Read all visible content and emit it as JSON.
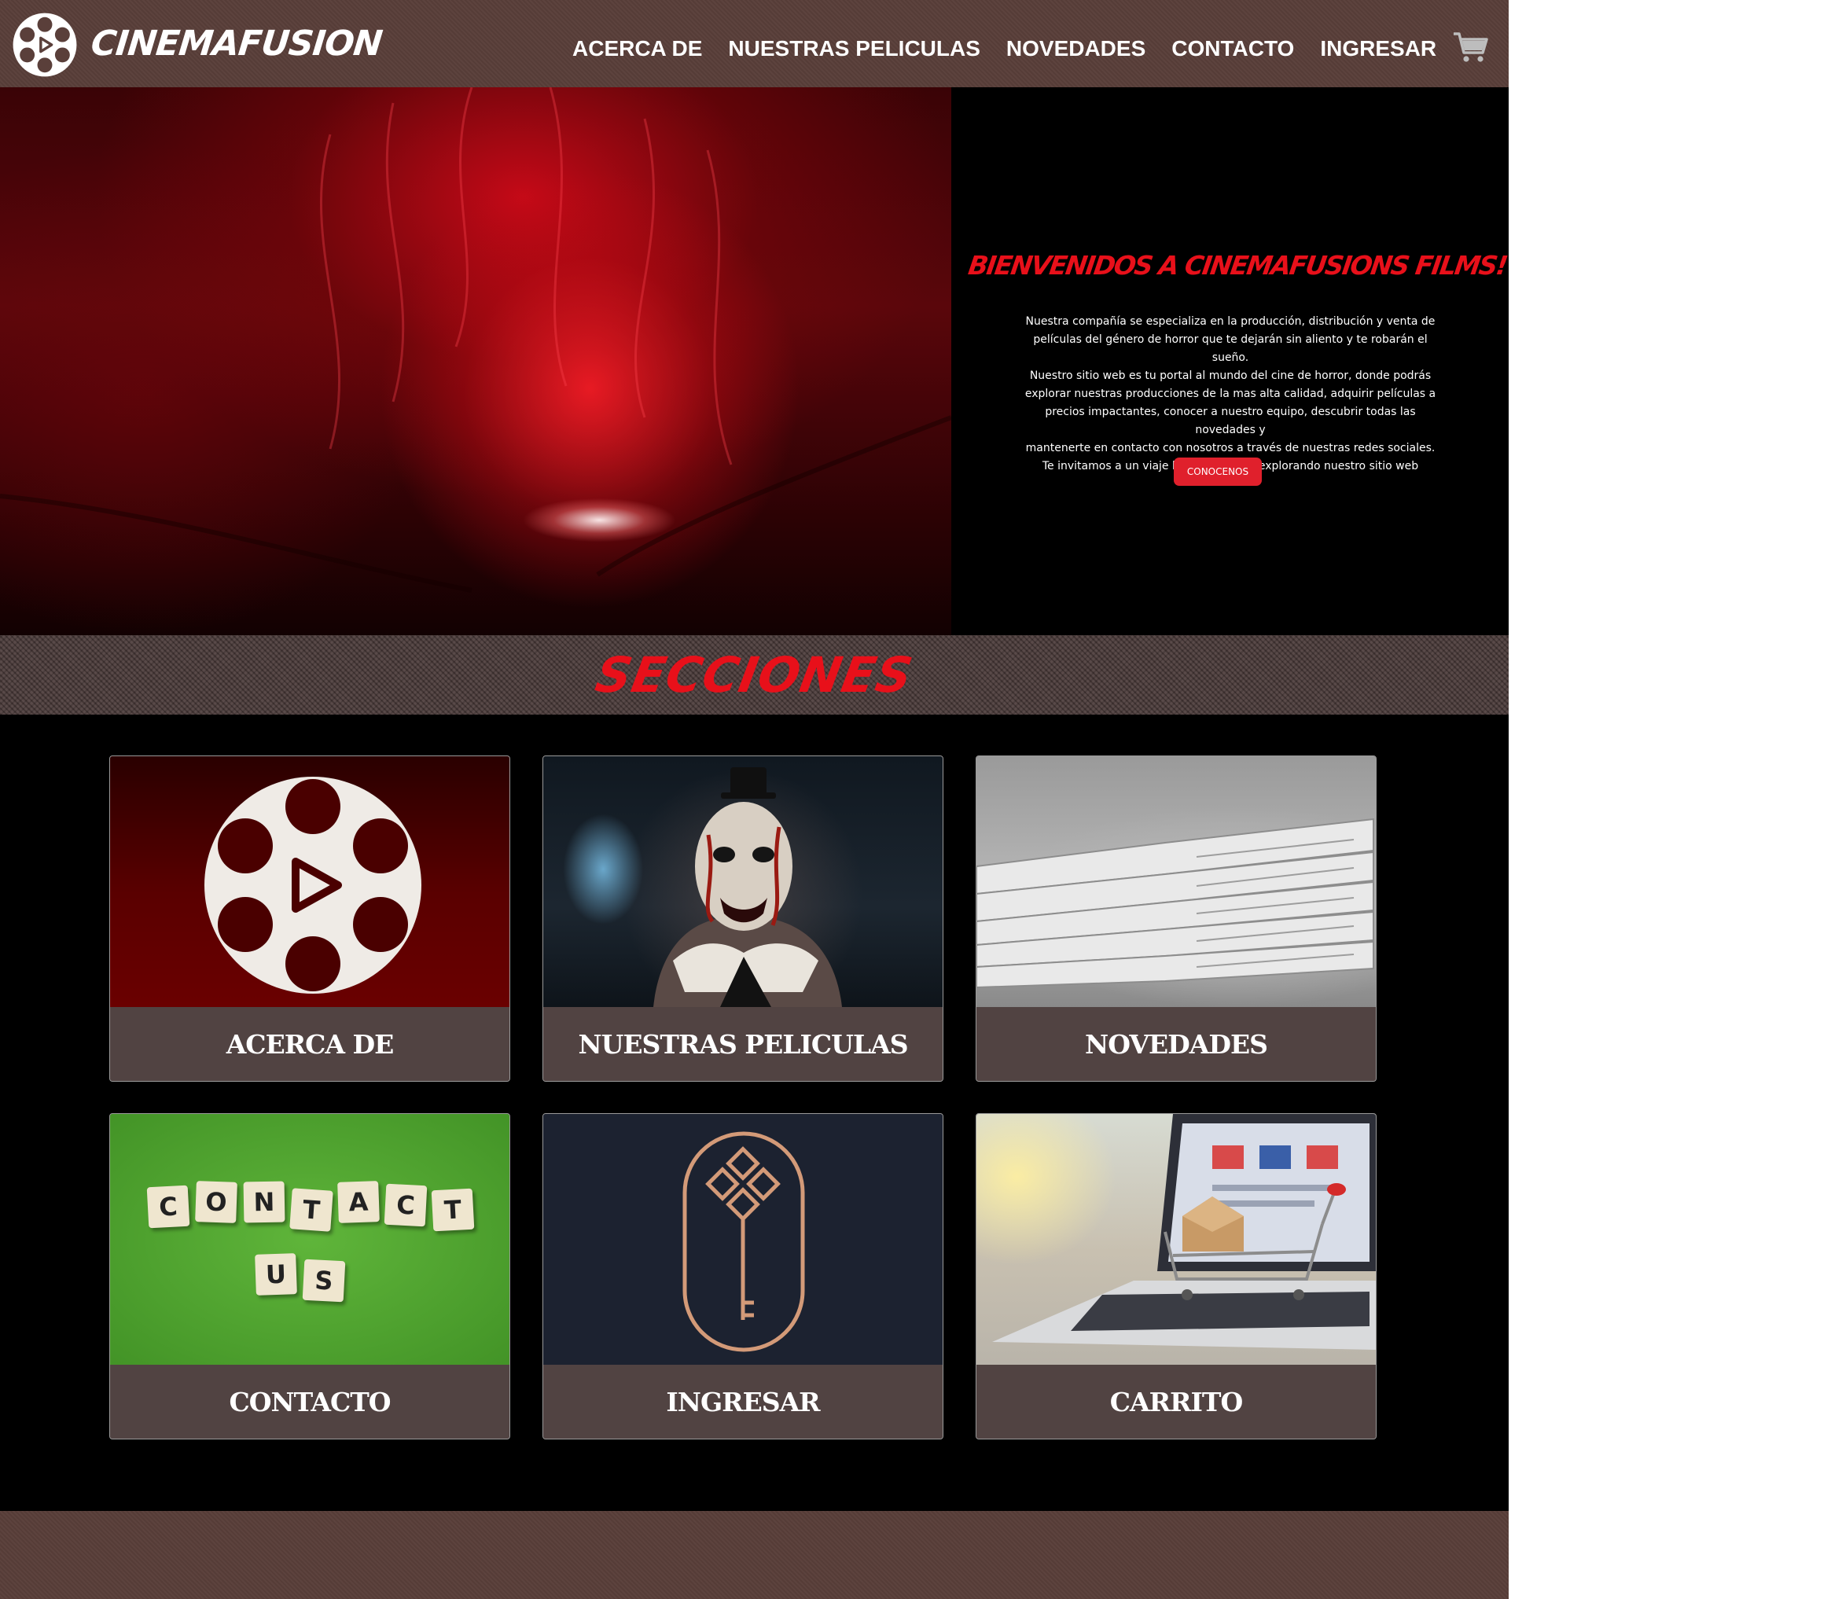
{
  "header": {
    "brand": "CINEMAFUSION",
    "nav": [
      "ACERCA DE",
      "NUESTRAS PELICULAS",
      "NOVEDADES",
      "CONTACTO",
      "INGRESAR"
    ],
    "cart_icon": "shopping-cart-icon"
  },
  "hero": {
    "title": "BIENVENIDOS A CINEMAFUSIONS FILMS!",
    "paragraph_lines": [
      "Nuestra compañía se especializa en la producción, distribución y venta de",
      "películas del género de horror que te dejarán sin aliento y te robarán el sueño.",
      "Nuestro sitio web es tu portal al mundo del cine de horror, donde podrás",
      "explorar nuestras producciones de la mas alta calidad, adquirir películas a",
      "precios impactantes, conocer a nuestro equipo, descubrir todas las novedades y",
      "mantenerte en contacto con nosotros a través de nuestras redes sociales.",
      "Te invitamos a un viaje hacia lo oscuro explorando nuestro sitio web"
    ],
    "button_label": "CONOCENOS"
  },
  "sections": {
    "title": "SECCIONES",
    "cards": [
      {
        "label": "ACERCA DE",
        "image": "film-reel-logo"
      },
      {
        "label": "NUESTRAS PELICULAS",
        "image": "horror-clown-photo"
      },
      {
        "label": "NOVEDADES",
        "image": "newspaper-stack-photo"
      },
      {
        "label": "CONTACTO",
        "image": "contact-us-scrabble-photo"
      },
      {
        "label": "INGRESAR",
        "image": "key-icon"
      },
      {
        "label": "CARRITO",
        "image": "shopping-cart-laptop-photo"
      }
    ],
    "scrabble_tiles": [
      "C",
      "O",
      "N",
      "T",
      "A",
      "C",
      "T",
      "U",
      "S"
    ]
  },
  "colors": {
    "header_bg": "#5a3f3a",
    "accent_red": "#e8101a",
    "button_red": "#e0202c",
    "card_caption_bg": "#514342",
    "key_bg": "#1c2230",
    "key_stroke": "#d39a78"
  }
}
